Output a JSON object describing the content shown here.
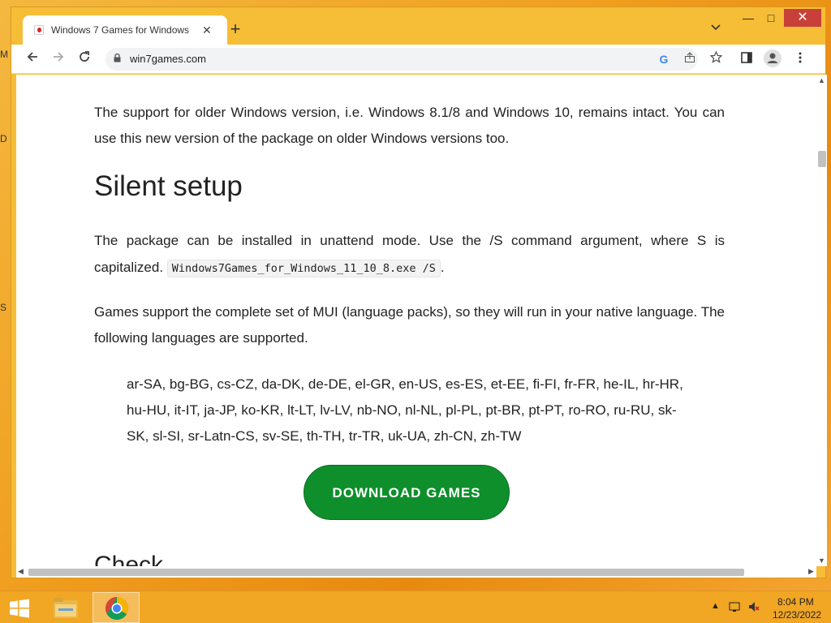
{
  "desktop": {
    "edge_letters": [
      "M",
      "D",
      "S"
    ]
  },
  "window": {
    "tab": {
      "title": "Windows 7 Games for Windows",
      "close_symbol": "✕"
    },
    "new_tab_symbol": "+",
    "tab_list_symbol": "⌄",
    "controls": {
      "minimize": "—",
      "maximize": "□",
      "close": "✕"
    }
  },
  "toolbar": {
    "back_icon": "back-arrow-icon",
    "forward_icon": "forward-arrow-icon",
    "reload_icon": "reload-icon",
    "url": "win7games.com",
    "google_letter": "G"
  },
  "page": {
    "intro": "The support for older Windows version, i.e. Windows 8.1/8 and Windows 10, remains intact. You can use this new version of the package on older Windows versions too.",
    "heading": "Silent setup",
    "silent_text_1": "The package can be installed in unattend mode. Use the /S command argument, where S is capitalized.",
    "silent_code": "Windows7Games_for_Windows_11_10_8.exe /S",
    "silent_text_end": ".",
    "mui_text": "Games support the complete set of MUI (language packs), so they will run in your native language. The following languages are supported.",
    "languages": "ar-SA, bg-BG, cs-CZ, da-DK, de-DE, el-GR, en-US, es-ES, et-EE, fi-FI, fr-FR, he-IL, hr-HR, hu-HU, it-IT, ja-JP, ko-KR, lt-LT, lv-LV, nb-NO, nl-NL, pl-PL, pt-BR, pt-PT, ro-RO, ru-RU, sk-SK, sl-SI, sr-Latn-CS, sv-SE, th-TH, tr-TR, uk-UA, zh-CN, zh-TW",
    "download_button": "DOWNLOAD GAMES",
    "next_heading_partial": "Check"
  },
  "taskbar": {
    "time": "8:04 PM",
    "date": "12/23/2022"
  },
  "colors": {
    "download_button": "#0e8f2b",
    "window_frame": "#f6bd36",
    "taskbar": "#f1a624"
  }
}
